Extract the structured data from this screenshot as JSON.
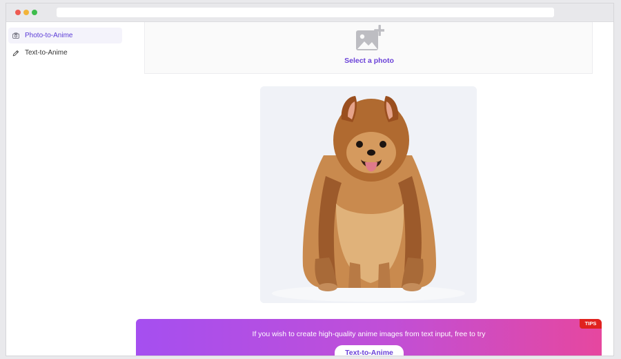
{
  "browser": {
    "url": ""
  },
  "sidebar": {
    "items": [
      {
        "label": "Photo-to-Anime",
        "icon": "camera-icon",
        "active": true
      },
      {
        "label": "Text-to-Anime",
        "icon": "pencil-icon",
        "active": false
      }
    ]
  },
  "upload": {
    "label": "Select a photo",
    "icon": "add-image-icon"
  },
  "preview": {
    "alt": "dog-image"
  },
  "banner": {
    "message": "If you wish to create high-quality anime images from text input, free to try",
    "badge": "TIPS",
    "button_label": "Text-to-Anime",
    "colors": {
      "start": "#a54ff0",
      "end": "#e6479f"
    }
  },
  "colors": {
    "accent": "#6a41d8",
    "badge": "#e0221f"
  }
}
